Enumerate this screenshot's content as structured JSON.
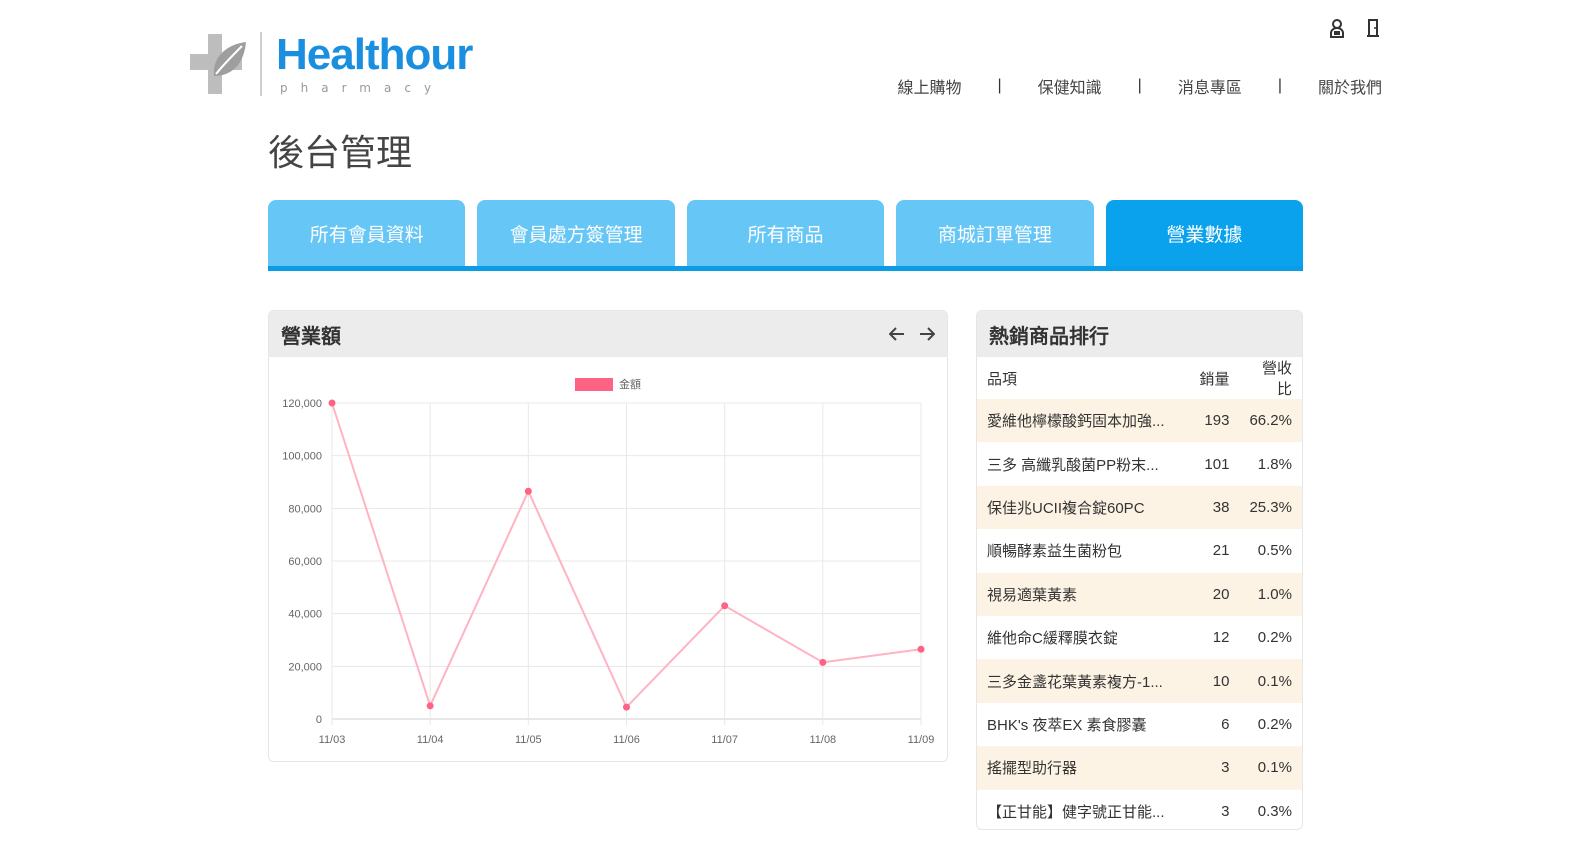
{
  "logo": {
    "name": "Healthour",
    "sub": "pharmacy"
  },
  "nav": [
    "線上購物",
    "保健知識",
    "消息專區",
    "關於我們"
  ],
  "nav_separator": "|",
  "page_title": "後台管理",
  "tabs": [
    {
      "label": "所有會員資料",
      "active": false
    },
    {
      "label": "會員處方簽管理",
      "active": false
    },
    {
      "label": "所有商品",
      "active": false
    },
    {
      "label": "商城訂單管理",
      "active": false
    },
    {
      "label": "營業數據",
      "active": true
    }
  ],
  "revenue": {
    "title": "營業額"
  },
  "chart_data": {
    "type": "line",
    "categories": [
      "11/03",
      "11/04",
      "11/05",
      "11/06",
      "11/07",
      "11/08",
      "11/09"
    ],
    "series": [
      {
        "name": "金額",
        "values": [
          120000,
          5000,
          86500,
          4500,
          43000,
          21500,
          26500
        ],
        "color": "#ff6384"
      }
    ],
    "ylim": [
      0,
      120000
    ],
    "yticks": [
      0,
      20000,
      40000,
      60000,
      80000,
      100000,
      120000
    ],
    "ytick_labels": [
      "0",
      "20,000",
      "40,000",
      "60,000",
      "80,000",
      "100,000",
      "120,000"
    ],
    "grid": true,
    "legend_position": "top-center"
  },
  "bestsellers": {
    "title": "熱銷商品排行",
    "headers": {
      "name": "品項",
      "qty": "銷量",
      "pct": "營收比"
    },
    "rows": [
      {
        "name": "愛維他檸檬酸鈣固本加強...",
        "qty": "193",
        "pct": "66.2%"
      },
      {
        "name": "三多 高纖乳酸菌PP粉末...",
        "qty": "101",
        "pct": "1.8%"
      },
      {
        "name": "保佳兆UCII複合錠60PC",
        "qty": "38",
        "pct": "25.3%"
      },
      {
        "name": "順暢酵素益生菌粉包",
        "qty": "21",
        "pct": "0.5%"
      },
      {
        "name": "視易適葉黃素",
        "qty": "20",
        "pct": "1.0%"
      },
      {
        "name": "維他命C緩釋膜衣錠",
        "qty": "12",
        "pct": "0.2%"
      },
      {
        "name": "三多金盞花葉黃素複方-1...",
        "qty": "10",
        "pct": "0.1%"
      },
      {
        "name": "BHK's 夜萃EX 素食膠囊",
        "qty": "6",
        "pct": "0.2%"
      },
      {
        "name": "搖擺型助行器",
        "qty": "3",
        "pct": "0.1%"
      },
      {
        "name": "【正甘能】健字號正甘能...",
        "qty": "3",
        "pct": "0.3%"
      }
    ]
  },
  "colors": {
    "brand": "#1a8fe0",
    "tab": "#66c6f5",
    "tab_active": "#0aa2ec",
    "row_alt": "#fdf3e5"
  }
}
